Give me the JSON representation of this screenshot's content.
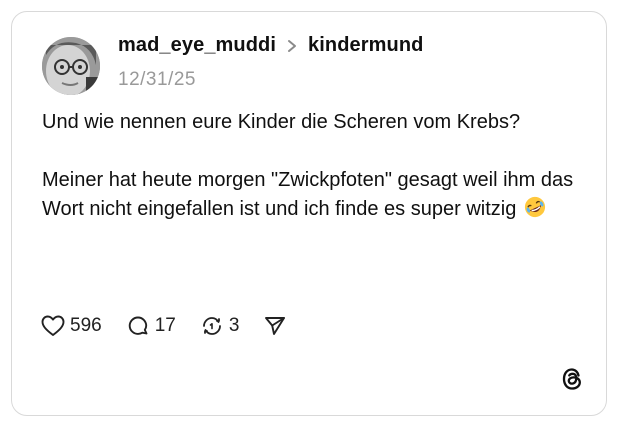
{
  "post": {
    "author": "mad_eye_muddi",
    "community": "kindermund",
    "date": "12/31/25",
    "paragraph1": "Und wie nennen eure Kinder die Scheren vom Krebs?",
    "paragraph2": "Meiner hat heute morgen \"Zwickpfoten\" gesagt weil ihm das Wort nicht eingefallen ist und ich finde es super witzig",
    "emoji": "rolling-on-floor-laughing-emoji"
  },
  "actions": {
    "likes": "596",
    "comments": "17",
    "reposts": "3",
    "share_icon": "send-icon"
  },
  "icons": {
    "like": "heart-icon",
    "comment": "comment-bubble-icon",
    "repost": "repost-icon",
    "logo": "threads-logo-icon"
  }
}
